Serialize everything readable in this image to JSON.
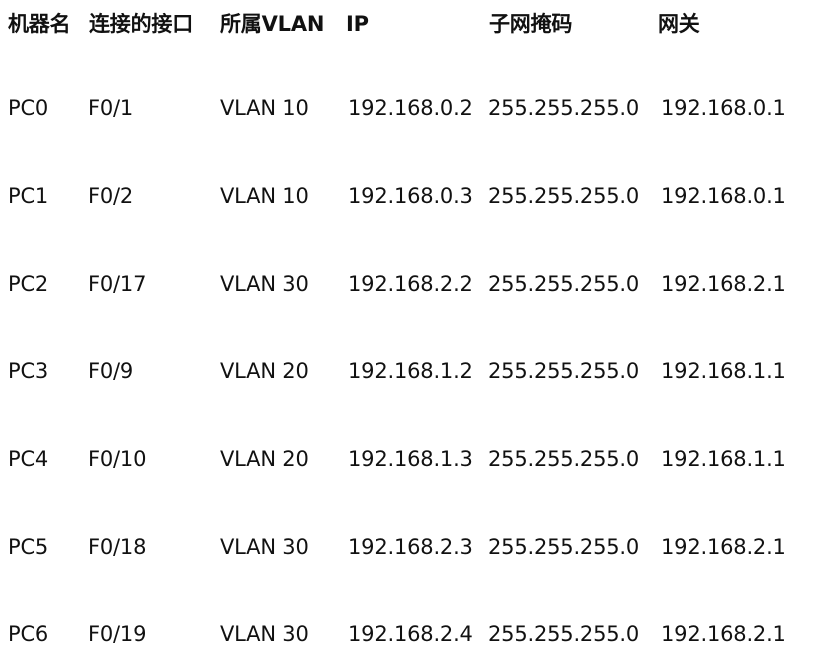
{
  "headers": {
    "name": "机器名",
    "port": "连接的接口",
    "vlan": "所属VLAN",
    "ip": "IP",
    "mask": "子网掩码",
    "gateway": "网关"
  },
  "rows": [
    {
      "name": "PC0",
      "port": "F0/1",
      "vlan": "VLAN 10",
      "ip": "192.168.0.2",
      "mask": "255.255.255.0",
      "gateway": "192.168.0.1"
    },
    {
      "name": "PC1",
      "port": "F0/2",
      "vlan": "VLAN 10",
      "ip": "192.168.0.3",
      "mask": "255.255.255.0",
      "gateway": "192.168.0.1"
    },
    {
      "name": "PC2",
      "port": "F0/17",
      "vlan": "VLAN 30",
      "ip": "192.168.2.2",
      "mask": "255.255.255.0",
      "gateway": "192.168.2.1"
    },
    {
      "name": "PC3",
      "port": "F0/9",
      "vlan": "VLAN 20",
      "ip": "192.168.1.2",
      "mask": "255.255.255.0",
      "gateway": "192.168.1.1"
    },
    {
      "name": "PC4",
      "port": "F0/10",
      "vlan": "VLAN 20",
      "ip": "192.168.1.3",
      "mask": "255.255.255.0",
      "gateway": "192.168.1.1"
    },
    {
      "name": "PC5",
      "port": "F0/18",
      "vlan": "VLAN 30",
      "ip": "192.168.2.3",
      "mask": "255.255.255.0",
      "gateway": "192.168.2.1"
    },
    {
      "name": "PC6",
      "port": "F0/19",
      "vlan": "VLAN 30",
      "ip": "192.168.2.4",
      "mask": "255.255.255.0",
      "gateway": "192.168.2.1"
    }
  ]
}
